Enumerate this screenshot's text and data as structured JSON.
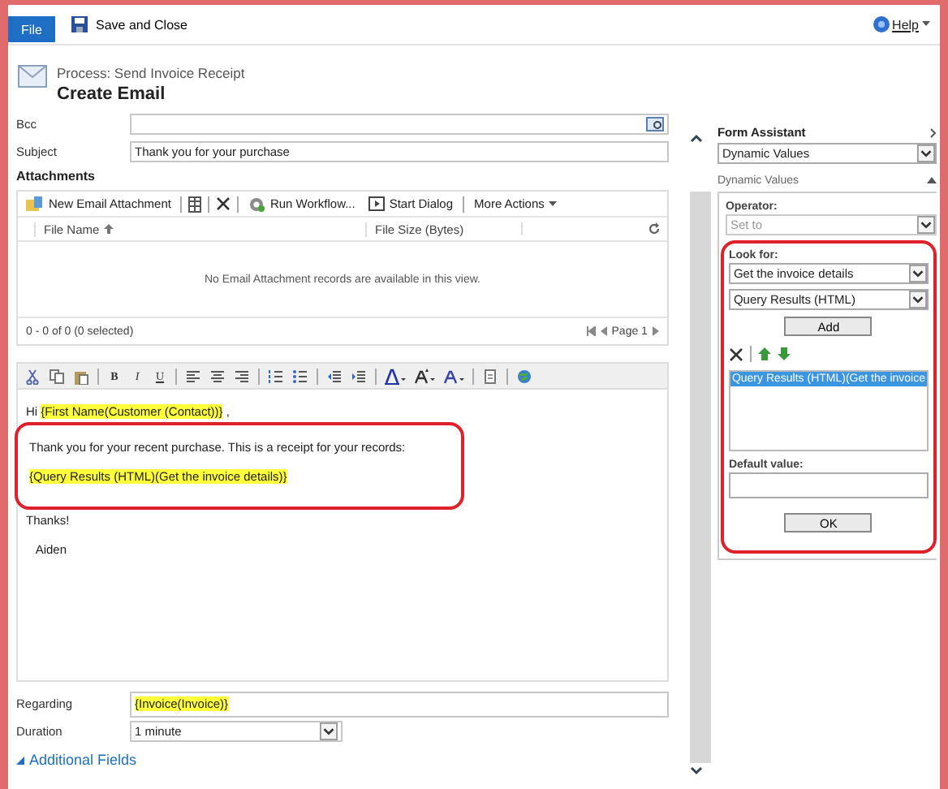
{
  "top_bar": {
    "file_tab": "File",
    "save_close": "Save and Close",
    "help": "Help"
  },
  "header": {
    "process": "Process: Send Invoice Receipt",
    "title": "Create Email"
  },
  "fields": [
    {
      "label": "Bcc",
      "kind": "lookup"
    },
    {
      "label": "Subject",
      "value": "Thank you for your purchase",
      "kind": "text"
    }
  ],
  "attachments": {
    "title": "Attachments",
    "toolbar": [
      {
        "kind": "new",
        "label": "New Email Attachment"
      },
      {
        "kind": "columns"
      },
      {
        "kind": "delete"
      },
      {
        "kind": "workflow",
        "label": "Run Workflow..."
      },
      {
        "kind": "dialog",
        "label": "Start Dialog"
      },
      {
        "kind": "menu",
        "label": "More Actions"
      }
    ],
    "columns": [
      "File Name",
      "File Size (Bytes)"
    ],
    "empty_message": "No Email Attachment records are available in this view.",
    "status": "0 - 0 of 0 (0 selected)",
    "page": "Page 1"
  },
  "editor": {
    "format_buttons": [
      "B",
      "I",
      "U"
    ],
    "blocks": [
      {
        "outlined": false,
        "lines": [
          [
            {
              "text": "Hi ",
              "highlighted": false
            },
            {
              "text": "{First Name(Customer (Contact))}",
              "highlighted": true
            },
            {
              "text": " ,",
              "highlighted": false
            }
          ]
        ]
      },
      {
        "outlined": true,
        "lines": [
          [
            {
              "text": "Thank you for your recent purchase. This is a receipt for your records:",
              "highlighted": false
            }
          ],
          [
            {
              "text": "{Query Results (HTML)(Get the invoice details)}",
              "highlighted": true
            }
          ]
        ]
      },
      {
        "outlined": false,
        "lines": [
          [
            {
              "text": "Thanks!",
              "highlighted": false
            }
          ],
          [
            {
              "text": "   Aiden",
              "highlighted": false
            }
          ]
        ]
      }
    ]
  },
  "regarding": {
    "label": "Regarding",
    "value": "{Invoice(Invoice)}",
    "highlighted": true
  },
  "duration": {
    "label": "Duration",
    "value": "1 minute"
  },
  "additional_fields": "Additional Fields",
  "form_assistant": {
    "title": "Form Assistant",
    "mode": "Dynamic Values",
    "section": "Dynamic Values",
    "operator_label": "Operator:",
    "operator": "Set to",
    "operator_disabled": true,
    "lookup_outlined": true,
    "look_for_label": "Look for:",
    "look_for": "Get the invoice details",
    "field": "Query Results (HTML)",
    "add": "Add",
    "values": [
      {
        "text": "Query Results (HTML)(Get the invoice",
        "selected": true
      }
    ],
    "default_label": "Default value:",
    "ok": "OK"
  }
}
